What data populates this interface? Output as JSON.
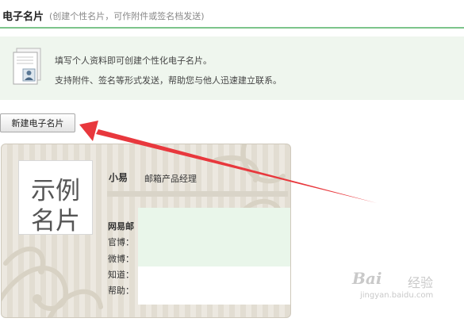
{
  "header": {
    "title": "电子名片",
    "subtitle": "(创建个性名片，可作附件或签名档发送)"
  },
  "info": {
    "icon": "business-card-doc-icon",
    "line1": "填写个人资料即可创建个性化电子名片。",
    "line2": "支持附件、签名等形式发送，帮助您与他人迅速建立联系。"
  },
  "toolbar": {
    "new_card_label": "新建电子名片"
  },
  "card": {
    "sample_line1": "示例",
    "sample_line2": "名片",
    "name": "小易",
    "job_title": "邮箱产品经理",
    "fields": {
      "company": "网易邮",
      "official_site": "官博：",
      "weibo": "微博：",
      "zhidao": "知道：",
      "help": "帮助："
    }
  },
  "watermark": {
    "logo": "Bai",
    "cn": "经验",
    "url": "jingyan.baidu.com"
  },
  "colors": {
    "accent_green": "#7cc48b",
    "info_bg": "#eff6ee",
    "arrow_red": "#e8383d"
  }
}
